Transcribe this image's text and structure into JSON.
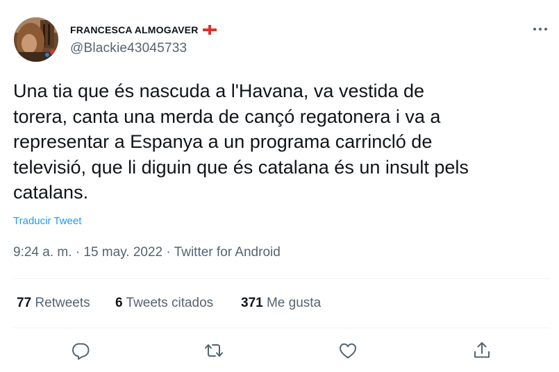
{
  "author": {
    "display_name": "FRANCESCA ALMOGAVER",
    "handle": "@Blackie43045733"
  },
  "tweet": {
    "text_lines": [
      "Una tia que és nascuda a l'Havana, va vestida de",
      "torera, canta una merda de cançó regatonera i va a",
      "representar a Espanya a un programa carrincló de",
      "televisió, que li diguin que és catalana és un insult pels",
      "catalans."
    ],
    "translate_label": "Traducir Tweet",
    "time": "9:24 a. m.",
    "date": "15 may. 2022",
    "source": "Twitter for Android",
    "separator": "·"
  },
  "stats": {
    "retweets_count": "77",
    "retweets_label": "Retweets",
    "quotes_count": "6",
    "quotes_label": "Tweets citados",
    "likes_count": "371",
    "likes_label": "Me gusta"
  },
  "icons": {
    "more": "more-horizontal-icon",
    "reply": "reply-icon",
    "retweet": "retweet-icon",
    "like": "like-icon",
    "share": "share-icon",
    "flag": "saint-george-flag-icon"
  },
  "colors": {
    "link": "#1d9bf0",
    "secondary_text": "#536471",
    "primary_text": "#0f1419",
    "divider": "#eff3f4"
  }
}
